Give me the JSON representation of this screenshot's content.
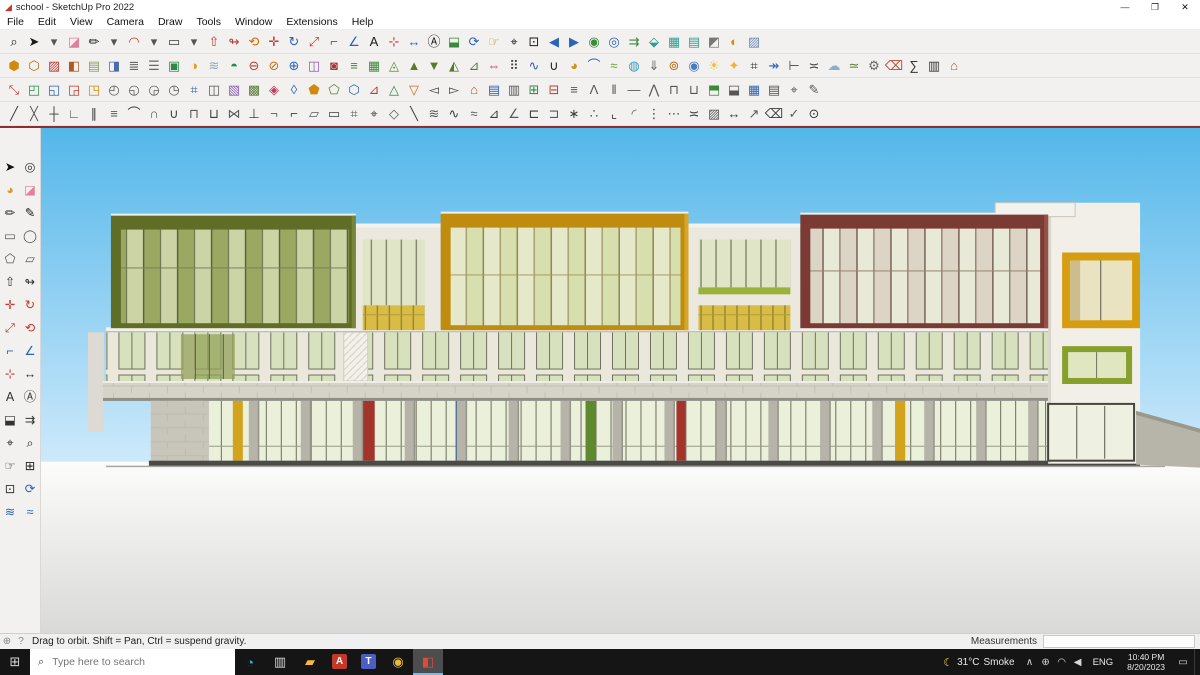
{
  "window": {
    "title": "school - SketchUp Pro 2022",
    "controls": [
      {
        "n": "minimize",
        "g": "—",
        "c": "#333"
      },
      {
        "n": "maximize",
        "g": "❐",
        "c": "#333"
      },
      {
        "n": "close",
        "g": "✕",
        "c": "#111"
      }
    ]
  },
  "menu": {
    "items": [
      "File",
      "Edit",
      "View",
      "Camera",
      "Draw",
      "Tools",
      "Window",
      "Extensions",
      "Help"
    ]
  },
  "toolbars": {
    "row1": [
      {
        "n": "zoom-window",
        "g": "⌕",
        "c": "#1a1a1a"
      },
      {
        "n": "select",
        "g": "➤",
        "c": "#1a1a1a"
      },
      {
        "n": "select-menu",
        "g": "▾",
        "c": "#555"
      },
      {
        "n": "eraser",
        "g": "◪",
        "c": "#e0809a"
      },
      {
        "n": "line",
        "g": "✏",
        "c": "#1a1a1a"
      },
      {
        "n": "line-menu",
        "g": "▾",
        "c": "#555"
      },
      {
        "n": "arc",
        "g": "◠",
        "c": "#c03a2e"
      },
      {
        "n": "arc-menu",
        "g": "▾",
        "c": "#555"
      },
      {
        "n": "rectangle",
        "g": "▭",
        "c": "#3a3a3a"
      },
      {
        "n": "rectangle-menu",
        "g": "▾",
        "c": "#555"
      },
      {
        "n": "push-pull",
        "g": "⇧",
        "c": "#c03a2e"
      },
      {
        "n": "follow-me",
        "g": "↬",
        "c": "#c03a2e"
      },
      {
        "n": "offset",
        "g": "⟲",
        "c": "#d06a10"
      },
      {
        "n": "move",
        "g": "✛",
        "c": "#c03a2e"
      },
      {
        "n": "rotate",
        "g": "↻",
        "c": "#2a63b8"
      },
      {
        "n": "scale",
        "g": "⤢",
        "c": "#c03a2e"
      },
      {
        "n": "tape-measure",
        "g": "⌐",
        "c": "#2a63b8"
      },
      {
        "n": "protractor",
        "g": "∠",
        "c": "#2a63b8"
      },
      {
        "n": "text",
        "g": "A",
        "c": "#1a1a1a"
      },
      {
        "n": "axes",
        "g": "⊹",
        "c": "#c03a2e"
      },
      {
        "n": "dimensions",
        "g": "↔",
        "c": "#2a63b8"
      },
      {
        "n": "3d-text",
        "g": "Ⓐ",
        "c": "#1a1a1a"
      },
      {
        "n": "section-plane",
        "g": "⬓",
        "c": "#3a8a3a"
      },
      {
        "n": "orbit",
        "g": "⟳",
        "c": "#2a63b8"
      },
      {
        "n": "pan",
        "g": "☞",
        "c": "#d09010"
      },
      {
        "n": "zoom",
        "g": "⌖",
        "c": "#1a1a1a"
      },
      {
        "n": "zoom-extents",
        "g": "⊡",
        "c": "#1a1a1a"
      },
      {
        "n": "previous-view",
        "g": "◀",
        "c": "#2a63b8"
      },
      {
        "n": "next-view",
        "g": "▶",
        "c": "#2a63b8"
      },
      {
        "n": "position-camera",
        "g": "◉",
        "c": "#3a8a3a"
      },
      {
        "n": "look-around",
        "g": "◎",
        "c": "#2a63b8"
      },
      {
        "n": "walk",
        "g": "⇉",
        "c": "#3a8a3a"
      },
      {
        "n": "iso-view",
        "g": "⬙",
        "c": "#2f9e8f"
      },
      {
        "n": "top-view",
        "g": "▦",
        "c": "#2f9e8f"
      },
      {
        "n": "front-view",
        "g": "▤",
        "c": "#2f9e8f"
      },
      {
        "n": "styles-toggle",
        "g": "◩",
        "c": "#777777"
      },
      {
        "n": "shadows-toggle",
        "g": "◐",
        "c": "#d09010"
      },
      {
        "n": "x-ray",
        "g": "▨",
        "c": "#6a8ab8"
      }
    ],
    "row2": [
      {
        "n": "make-component",
        "g": "⬢",
        "c": "#d08a10"
      },
      {
        "n": "component-options",
        "g": "⬡",
        "c": "#b06a10"
      },
      {
        "n": "paint-bucket",
        "g": "▨",
        "c": "#c03a2e"
      },
      {
        "n": "materials",
        "g": "◧",
        "c": "#b05a20"
      },
      {
        "n": "match-photo",
        "g": "▤",
        "c": "#8aa05a"
      },
      {
        "n": "styles-panel",
        "g": "◨",
        "c": "#4a6ab0"
      },
      {
        "n": "tags",
        "g": "≣",
        "c": "#666666"
      },
      {
        "n": "outliner",
        "g": "☰",
        "c": "#666666"
      },
      {
        "n": "scenes",
        "g": "▣",
        "c": "#2a8a4a"
      },
      {
        "n": "shadow-settings",
        "g": "◑",
        "c": "#e09a10"
      },
      {
        "n": "fog",
        "g": "≋",
        "c": "#8aaabf"
      },
      {
        "n": "solid-union",
        "g": "◓",
        "c": "#2a8a4a"
      },
      {
        "n": "solid-subtract",
        "g": "⊖",
        "c": "#c03a2e"
      },
      {
        "n": "solid-trim",
        "g": "⊘",
        "c": "#d06a10"
      },
      {
        "n": "solid-intersect",
        "g": "⊕",
        "c": "#2a63b8"
      },
      {
        "n": "solid-split",
        "g": "◫",
        "c": "#8a5ab8"
      },
      {
        "n": "outer-shell",
        "g": "◙",
        "c": "#a03a3a"
      },
      {
        "n": "from-contours",
        "g": "≡",
        "c": "#3a8a3a"
      },
      {
        "n": "from-scratch",
        "g": "▦",
        "c": "#3a8a3a"
      },
      {
        "n": "smoove",
        "g": "◬",
        "c": "#5a8a2a"
      },
      {
        "n": "stamp",
        "g": "▲",
        "c": "#5a7a2a"
      },
      {
        "n": "drape",
        "g": "▼",
        "c": "#5a7a2a"
      },
      {
        "n": "add-detail",
        "g": "◭",
        "c": "#5a7a2a"
      },
      {
        "n": "flip-edge",
        "g": "⊿",
        "c": "#5a7a2a"
      },
      {
        "n": "mirror",
        "g": "⇔",
        "c": "#c23a5a"
      },
      {
        "n": "array",
        "g": "⠿",
        "c": "#444444"
      },
      {
        "n": "bezier-curve",
        "g": "∿",
        "c": "#2a63b8"
      },
      {
        "n": "weld",
        "g": "∪",
        "c": "#1a1a1a"
      },
      {
        "n": "round-corner",
        "g": "◕",
        "c": "#d09010"
      },
      {
        "n": "joint-push-pull",
        "g": "⌒",
        "c": "#2a63b8"
      },
      {
        "n": "curviloft",
        "g": "≈",
        "c": "#6aa03a"
      },
      {
        "n": "soap-bubble",
        "g": "◍",
        "c": "#3a9ac0"
      },
      {
        "n": "drop-to-ground",
        "g": "⇓",
        "c": "#666666"
      },
      {
        "n": "pipe-along-path",
        "g": "⊚",
        "c": "#c06a10"
      },
      {
        "n": "render",
        "g": "◉",
        "c": "#4a7ac0"
      },
      {
        "n": "light",
        "g": "☀",
        "c": "#f0c030"
      },
      {
        "n": "spot-light",
        "g": "✦",
        "c": "#f0b030"
      },
      {
        "n": "camera-tools",
        "g": "⌗",
        "c": "#333333"
      },
      {
        "n": "walkthrough",
        "g": "↠",
        "c": "#2a63b8"
      },
      {
        "n": "label",
        "g": "⊢",
        "c": "#444444"
      },
      {
        "n": "dim-linear",
        "g": "≍",
        "c": "#444444"
      },
      {
        "n": "cloud",
        "g": "☁",
        "c": "#8ab0c8"
      },
      {
        "n": "terrain",
        "g": "≃",
        "c": "#5a7a2a"
      },
      {
        "n": "preferences",
        "g": "⚙",
        "c": "#666666"
      },
      {
        "n": "purge",
        "g": "⌫",
        "c": "#c04a3a"
      },
      {
        "n": "statistics",
        "g": "∑",
        "c": "#333333"
      },
      {
        "n": "report",
        "g": "▥",
        "c": "#333333"
      },
      {
        "n": "warehouse",
        "g": "⌂",
        "c": "#b05a20"
      }
    ],
    "row3": [
      {
        "n": "fredo-scale",
        "g": "⤡",
        "c": "#c03a2e"
      },
      {
        "n": "box-stretch",
        "g": "◰",
        "c": "#2a8a4a"
      },
      {
        "n": "box-taper",
        "g": "◱",
        "c": "#2a63b8"
      },
      {
        "n": "box-shear",
        "g": "◲",
        "c": "#c03a2e"
      },
      {
        "n": "box-twist",
        "g": "◳",
        "c": "#d08a10"
      },
      {
        "n": "radial-bend",
        "g": "◴",
        "c": "#555555"
      },
      {
        "n": "bend",
        "g": "◵",
        "c": "#555555"
      },
      {
        "n": "spiral",
        "g": "◶",
        "c": "#555555"
      },
      {
        "n": "lattice",
        "g": "◷",
        "c": "#555555"
      },
      {
        "n": "grid",
        "g": "⌗",
        "c": "#2a63b8"
      },
      {
        "n": "divide",
        "g": "◫",
        "c": "#555555"
      },
      {
        "n": "panelize",
        "g": "▧",
        "c": "#8a5ab8"
      },
      {
        "n": "quad-face",
        "g": "▩",
        "c": "#5a7a3a"
      },
      {
        "n": "uv-map",
        "g": "◈",
        "c": "#c23a5a"
      },
      {
        "n": "texture-tool",
        "g": "◊",
        "c": "#2a63b8"
      },
      {
        "n": "project-texture",
        "g": "⬟",
        "c": "#d08a10"
      },
      {
        "n": "unwrap",
        "g": "⬠",
        "c": "#5a7a2a"
      },
      {
        "n": "hexify",
        "g": "⬡",
        "c": "#2a63b8"
      },
      {
        "n": "triangulate",
        "g": "⊿",
        "c": "#c03a2e"
      },
      {
        "n": "smooth",
        "g": "△",
        "c": "#2a8a4a"
      },
      {
        "n": "unsmooth",
        "g": "▽",
        "c": "#d06a10"
      },
      {
        "n": "reverse-faces",
        "g": "◅",
        "c": "#444444"
      },
      {
        "n": "orient-faces",
        "g": "▻",
        "c": "#444444"
      },
      {
        "n": "make-house",
        "g": "⌂",
        "c": "#b05434"
      },
      {
        "n": "floor-generator",
        "g": "▤",
        "c": "#2a63b8"
      },
      {
        "n": "wall-generator",
        "g": "▥",
        "c": "#555555"
      },
      {
        "n": "window-generator",
        "g": "⊞",
        "c": "#2a8a4a"
      },
      {
        "n": "door-generator",
        "g": "⊟",
        "c": "#c03a2e"
      },
      {
        "n": "stair-generator",
        "g": "≡",
        "c": "#555555"
      },
      {
        "n": "roof-generator",
        "g": "Λ",
        "c": "#555555"
      },
      {
        "n": "column-generator",
        "g": "‖",
        "c": "#555555"
      },
      {
        "n": "beam-generator",
        "g": "―",
        "c": "#555555"
      },
      {
        "n": "truss-generator",
        "g": "⋀",
        "c": "#555555"
      },
      {
        "n": "frame-generator",
        "g": "⊓",
        "c": "#555555"
      },
      {
        "n": "slab-generator",
        "g": "⊔",
        "c": "#555555"
      },
      {
        "n": "section-fill",
        "g": "⬒",
        "c": "#3a8a3a"
      },
      {
        "n": "section-line",
        "g": "⬓",
        "c": "#555555"
      },
      {
        "n": "plan-view",
        "g": "▦",
        "c": "#2a63b8"
      },
      {
        "n": "elevation-view",
        "g": "▤",
        "c": "#555555"
      },
      {
        "n": "detail-view",
        "g": "⌖",
        "c": "#555555"
      },
      {
        "n": "annotate",
        "g": "✎",
        "c": "#555555"
      }
    ],
    "row4": [
      {
        "n": "line-2d",
        "g": "╱",
        "c": "#3c3c3c"
      },
      {
        "n": "cross-2d",
        "g": "╳",
        "c": "#5a5a5a"
      },
      {
        "n": "midpoint",
        "g": "┼",
        "c": "#3c3c3c"
      },
      {
        "n": "corner",
        "g": "∟",
        "c": "#5a5a5a"
      },
      {
        "n": "parallel",
        "g": "∥",
        "c": "#3c3c3c"
      },
      {
        "n": "stack",
        "g": "≡",
        "c": "#5a5a5a"
      },
      {
        "n": "arc-2d",
        "g": "⌒",
        "c": "#3c3c3c"
      },
      {
        "n": "intersect-2d",
        "g": "∩",
        "c": "#5a5a5a"
      },
      {
        "n": "union-2d",
        "g": "∪",
        "c": "#3c3c3c"
      },
      {
        "n": "cap-2d",
        "g": "⊓",
        "c": "#5a5a5a"
      },
      {
        "n": "cup-2d",
        "g": "⊔",
        "c": "#3c3c3c"
      },
      {
        "n": "join-2d",
        "g": "⋈",
        "c": "#5a5a5a"
      },
      {
        "n": "perpendicular",
        "g": "⊥",
        "c": "#3c3c3c"
      },
      {
        "n": "negate",
        "g": "¬",
        "c": "#5a5a5a"
      },
      {
        "n": "trim-2d",
        "g": "⌐",
        "c": "#3c3c3c"
      },
      {
        "n": "parallelogram",
        "g": "▱",
        "c": "#5a5a5a"
      },
      {
        "n": "rect-2d",
        "g": "▭",
        "c": "#3c3c3c"
      },
      {
        "n": "grid-snap",
        "g": "⌗",
        "c": "#5a5a5a"
      },
      {
        "n": "center-mark",
        "g": "⌖",
        "c": "#3c3c3c"
      },
      {
        "n": "diamond",
        "g": "◇",
        "c": "#5a5a5a"
      },
      {
        "n": "mirror-line",
        "g": "╲",
        "c": "#3c3c3c"
      },
      {
        "n": "waves",
        "g": "≋",
        "c": "#5a5a5a"
      },
      {
        "n": "sine",
        "g": "∿",
        "c": "#3c3c3c"
      },
      {
        "n": "approx",
        "g": "≈",
        "c": "#5a5a5a"
      },
      {
        "n": "triangle-2d",
        "g": "⊿",
        "c": "#3c3c3c"
      },
      {
        "n": "angle-2d",
        "g": "∠",
        "c": "#5a5a5a"
      },
      {
        "n": "flatten",
        "g": "⊏",
        "c": "#3c3c3c"
      },
      {
        "n": "project-2d",
        "g": "⊐",
        "c": "#5a5a5a"
      },
      {
        "n": "explode",
        "g": "∗",
        "c": "#3c3c3c"
      },
      {
        "n": "weld-2d",
        "g": "∴",
        "c": "#5a5a5a"
      },
      {
        "n": "chamfer",
        "g": "⌞",
        "c": "#3c3c3c"
      },
      {
        "n": "fillet",
        "g": "◜",
        "c": "#5a5a5a"
      },
      {
        "n": "array-linear",
        "g": "⋮",
        "c": "#3c3c3c"
      },
      {
        "n": "array-radial",
        "g": "⋯",
        "c": "#5a5a5a"
      },
      {
        "n": "measure-2d",
        "g": "≍",
        "c": "#3c3c3c"
      },
      {
        "n": "hatch",
        "g": "▨",
        "c": "#5a5a5a"
      },
      {
        "n": "dimension-2d",
        "g": "↔",
        "c": "#3c3c3c"
      },
      {
        "n": "leader",
        "g": "↗",
        "c": "#5a5a5a"
      },
      {
        "n": "cleanup",
        "g": "⌫",
        "c": "#3c3c3c"
      },
      {
        "n": "fix-faces",
        "g": "✓",
        "c": "#5a5a5a"
      },
      {
        "n": "inspect",
        "g": "⊙",
        "c": "#3c3c3c"
      }
    ],
    "left": [
      {
        "n": "select-tool",
        "g": "➤",
        "c": "#111111"
      },
      {
        "n": "look-around-tool",
        "g": "◎",
        "c": "#333333"
      },
      {
        "n": "paint-roller",
        "g": "◕",
        "c": "#d0a030"
      },
      {
        "n": "eraser-tool",
        "g": "◪",
        "c": "#e0809a"
      },
      {
        "n": "pencil",
        "g": "✏",
        "c": "#222222"
      },
      {
        "n": "freehand",
        "g": "✎",
        "c": "#222222"
      },
      {
        "n": "rectangle-tool",
        "g": "▭",
        "c": "#555555"
      },
      {
        "n": "circle-tool",
        "g": "◯",
        "c": "#555555"
      },
      {
        "n": "polygon-tool",
        "g": "⬠",
        "c": "#555555"
      },
      {
        "n": "rotated-rectangle",
        "g": "▱",
        "c": "#555555"
      },
      {
        "n": "push-pull-tool",
        "g": "⇧",
        "c": "#333333"
      },
      {
        "n": "follow-me-tool",
        "g": "↬",
        "c": "#333333"
      },
      {
        "n": "move-tool",
        "g": "✛",
        "c": "#c03a2e"
      },
      {
        "n": "rotate-tool",
        "g": "↻",
        "c": "#c03a2e"
      },
      {
        "n": "scale-tool",
        "g": "⤢",
        "c": "#c03a2e"
      },
      {
        "n": "offset-tool",
        "g": "⟲",
        "c": "#c03a2e"
      },
      {
        "n": "tape-measure-tool",
        "g": "⌐",
        "c": "#2a63b8"
      },
      {
        "n": "protractor-tool",
        "g": "∠",
        "c": "#2a63b8"
      },
      {
        "n": "axes-tool",
        "g": "⊹",
        "c": "#c03a2e"
      },
      {
        "n": "dimension-tool",
        "g": "↔",
        "c": "#333333"
      },
      {
        "n": "text-tool",
        "g": "A",
        "c": "#333333"
      },
      {
        "n": "3d-text-tool",
        "g": "Ⓐ",
        "c": "#333333"
      },
      {
        "n": "section-plane-tool",
        "g": "⬓",
        "c": "#333333"
      },
      {
        "n": "walk-tool",
        "g": "⇉",
        "c": "#333333"
      },
      {
        "n": "position-camera-tool",
        "g": "⌖",
        "c": "#333333"
      },
      {
        "n": "zoom-tool",
        "g": "⌕",
        "c": "#222222"
      },
      {
        "n": "pan-tool",
        "g": "☞",
        "c": "#333333"
      },
      {
        "n": "zoom-window-tool",
        "g": "⊞",
        "c": "#222222"
      },
      {
        "n": "zoom-extents-tool",
        "g": "⊡",
        "c": "#333333"
      },
      {
        "n": "orbit-tool",
        "g": "⟳",
        "c": "#2a63b8"
      },
      {
        "n": "classifier",
        "g": "≋",
        "c": "#2a63b8"
      },
      {
        "n": "report-tool",
        "g": "≈",
        "c": "#2a63b8"
      }
    ]
  },
  "statusbar": {
    "icons": [
      {
        "n": "geolocate",
        "g": "⊕",
        "c": "#888888"
      },
      {
        "n": "context-help",
        "g": "?",
        "c": "#888888"
      }
    ],
    "hint": "Drag to orbit. Shift = Pan, Ctrl = suspend gravity.",
    "measurements_label": "Measurements",
    "measurements_value": ""
  },
  "taskbar": {
    "search_placeholder": "Type here to search",
    "start_glyph": "⊞",
    "apps": [
      {
        "n": "cortana-orb",
        "g": "◔",
        "c": "#35b3e8"
      },
      {
        "n": "task-view",
        "g": "▥",
        "c": "#d7d7d7"
      },
      {
        "n": "file-explorer",
        "g": "▰",
        "c": "#f5b83d"
      },
      {
        "n": "autocad",
        "g": "A",
        "c": "#ffffff",
        "bg": "#c0392b"
      },
      {
        "n": "teams",
        "g": "T",
        "c": "#ffffff",
        "bg": "#4a5fc0"
      },
      {
        "n": "chrome",
        "g": "◉",
        "c": "#e8b93c"
      },
      {
        "n": "sketchup",
        "g": "◧",
        "c": "#e04a3a",
        "active": true
      }
    ],
    "weather": {
      "icon": "☾",
      "temp": "31°C",
      "desc": "Smoke"
    },
    "tray": [
      {
        "n": "chevron-up",
        "g": "∧",
        "c": "#d7d7d7"
      },
      {
        "n": "network",
        "g": "⊕",
        "c": "#d7d7d7"
      },
      {
        "n": "wifi",
        "g": "◠",
        "c": "#d7d7d7"
      },
      {
        "n": "volume",
        "g": "◀",
        "c": "#d7d7d7"
      }
    ],
    "language": "ENG",
    "time": "10:40 PM",
    "date": "8/20/2023",
    "action_center_glyph": "▭"
  },
  "colors": {
    "sky_top": "#54b7ea",
    "sky_bottom": "#cfeafb",
    "ground_light": "#fcfcfa",
    "ground_dark": "#d9d9d7",
    "wall": "#ebe8dd",
    "olive": "#5f6d26",
    "mustard": "#bf8c0f",
    "maroon": "#7b3a33",
    "stone": "#d6d3c9",
    "pier": "#b6b3a9",
    "base_dark": "#4b4a45",
    "accent_yellow": "#d2a31c",
    "accent_red": "#a2342c",
    "accent_blue": "#1f4d8f",
    "accent_green": "#5e8a2d",
    "frame_yellow": "#d79d10",
    "frame_green": "#87a02c",
    "taskbar_bg": "#151515",
    "active_app_bg": "#4d4d4d",
    "accent_line": "#8b2f2f"
  }
}
